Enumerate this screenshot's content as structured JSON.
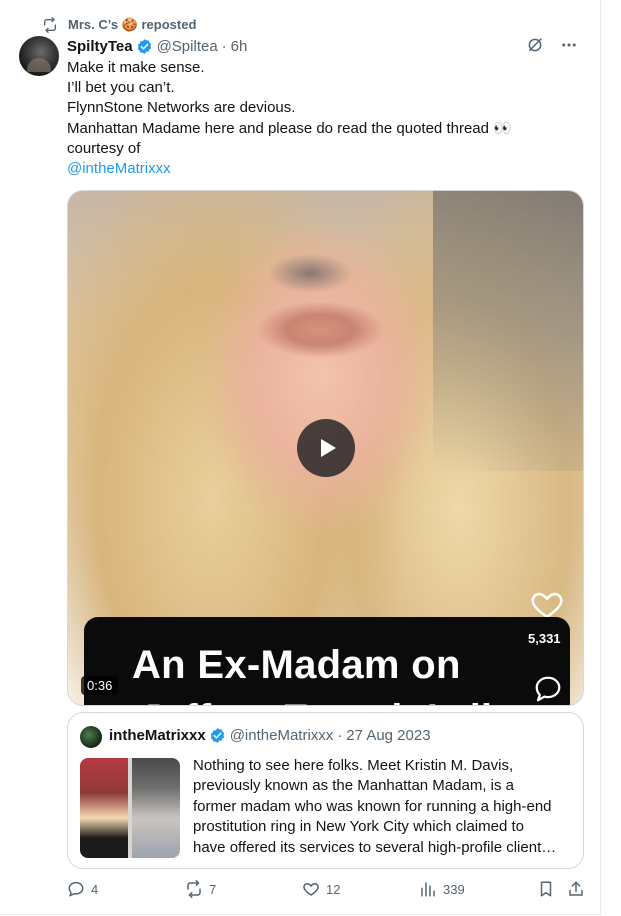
{
  "repost": {
    "label": "Mrs. C’s 🍪 reposted"
  },
  "tweet": {
    "author_name": "SpiltyTea",
    "handle": "@Spiltea",
    "separator": "·",
    "time": "6h",
    "lines": [
      "Make it make sense.",
      "I’ll bet you can’t.",
      "FlynnStone Networks are devious.",
      "Manhattan Madame here and please do read the quoted thread 👀",
      "courtesy of"
    ],
    "mention": "@intheMatrixxx"
  },
  "media": {
    "caption_line1": "An Ex-Madam on",
    "caption_line2": "Jeffrey Epstein’s list",
    "likes": "5,331",
    "duration": "0:36"
  },
  "quote": {
    "author_name": "intheMatrixxx",
    "handle": "@intheMatrixxx",
    "separator": "·",
    "date": "27 Aug 2023",
    "lines": [
      "Nothing to see here folks. Meet Kristin M. Davis,",
      "previously known as the Manhattan Madam, is a",
      "former madam who was known for running a high-end",
      "prostitution ring in New York City which claimed to",
      "have offered its services to several high-profile client…"
    ]
  },
  "actions": {
    "replies": "4",
    "reposts": "7",
    "likes": "12",
    "views": "339"
  },
  "colors": {
    "accent": "#1d9bf0",
    "text": "#0f1419",
    "muted": "#536471",
    "border": "#cfd9de"
  }
}
